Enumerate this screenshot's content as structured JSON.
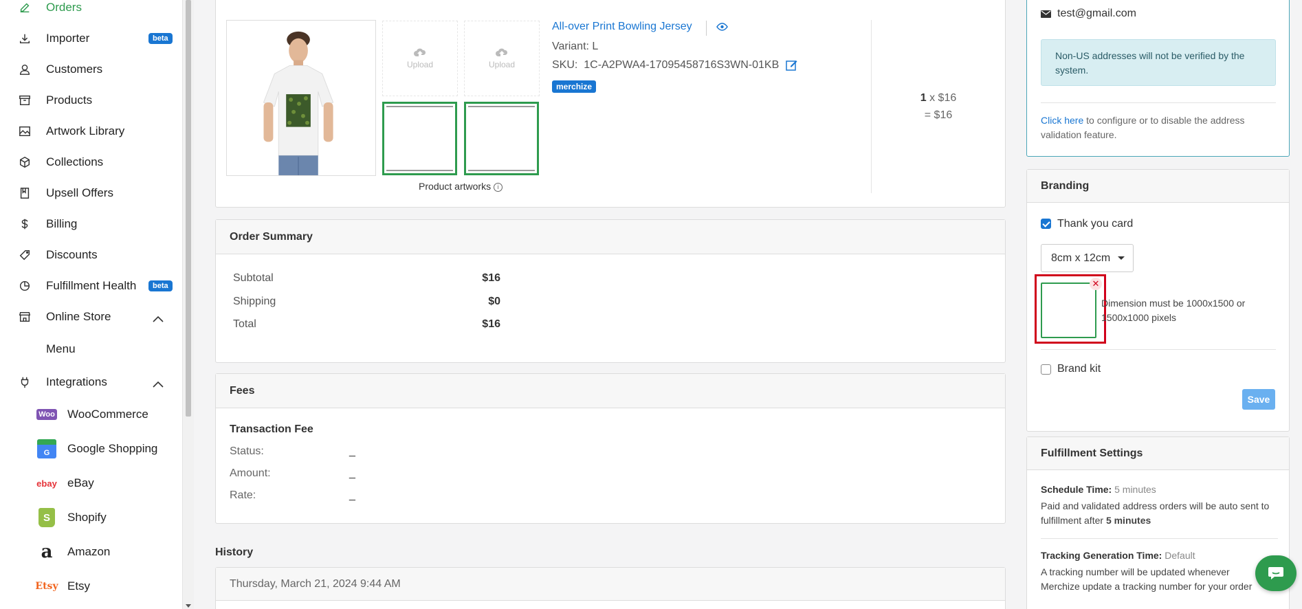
{
  "sidebar": {
    "items": [
      {
        "label": "Orders",
        "icon": "edit-icon"
      },
      {
        "label": "Importer",
        "icon": "download-icon",
        "badge": "beta"
      },
      {
        "label": "Customers",
        "icon": "user-icon"
      },
      {
        "label": "Products",
        "icon": "archive-icon"
      },
      {
        "label": "Artwork Library",
        "icon": "image-icon"
      },
      {
        "label": "Collections",
        "icon": "box-icon"
      },
      {
        "label": "Upsell Offers",
        "icon": "bookmark-icon"
      },
      {
        "label": "Billing",
        "icon": "dollar-icon"
      },
      {
        "label": "Discounts",
        "icon": "tag-icon"
      },
      {
        "label": "Fulfillment Health",
        "icon": "pie-chart-icon",
        "badge": "beta"
      },
      {
        "label": "Online Store",
        "icon": "store-icon"
      },
      {
        "label": "Integrations",
        "icon": "plug-icon"
      }
    ],
    "online_store_sub": [
      "Menu"
    ],
    "integrations_sub": [
      {
        "label": "WooCommerce",
        "logo_text": "Woo"
      },
      {
        "label": "Google Shopping",
        "logo_text": "G"
      },
      {
        "label": "eBay",
        "logo_text": "ebay"
      },
      {
        "label": "Shopify",
        "logo_text": "S"
      },
      {
        "label": "Amazon",
        "logo_text": "a"
      },
      {
        "label": "Etsy",
        "logo_text": "Etsy"
      }
    ]
  },
  "product": {
    "title": "All-over Print Bowling Jersey",
    "variant": "Variant: L",
    "sku_label": "SKU:",
    "sku": "1C-A2PWA4-17095458716S3WN-01KB",
    "tag": "merchize",
    "upload_label": "Upload",
    "artworks_caption": "Product artworks",
    "qty": "1",
    "unit_price": "x $16",
    "line_total": "= $16"
  },
  "order_summary": {
    "title": "Order Summary",
    "rows": [
      {
        "label": "Subtotal",
        "value": "$16"
      },
      {
        "label": "Shipping",
        "value": "$0"
      },
      {
        "label": "Total",
        "value": "$16"
      }
    ]
  },
  "fees": {
    "title": "Fees",
    "subtitle": "Transaction Fee",
    "rows": [
      {
        "label": "Status:",
        "value": "_"
      },
      {
        "label": "Amount:",
        "value": "_"
      },
      {
        "label": "Rate:",
        "value": "_"
      }
    ]
  },
  "history": {
    "title": "History",
    "entry_date": "Thursday, March 21, 2024 9:44 AM"
  },
  "address": {
    "email": "test@gmail.com",
    "notice": "Non-US addresses will not be verified by the system.",
    "click_here": "Click here",
    "config_text": "to configure or to disable the address validation feature."
  },
  "branding": {
    "title": "Branding",
    "thank_you_label": "Thank you card",
    "thank_you_checked": true,
    "size_value": "8cm x 12cm",
    "dimension_note": "Dimension must be 1000x1500 or 1500x1000 pixels",
    "brand_kit_label": "Brand kit",
    "brand_kit_checked": false,
    "save_label": "Save"
  },
  "fulfillment": {
    "title": "Fulfillment Settings",
    "schedule_label": "Schedule Time:",
    "schedule_value": "5 minutes",
    "schedule_desc": "Paid and validated address orders will be auto sent to fulfillment after",
    "schedule_desc_bold": "5 minutes",
    "tracking_label": "Tracking Generation Time:",
    "tracking_value": "Default",
    "tracking_desc": "A tracking number will be updated whenever Merchize update a tracking number for your order"
  },
  "colors": {
    "accent": "#2e9b4e",
    "link": "#1976d2",
    "highlight": "#d0021b",
    "notice_bg": "#d8eef2"
  }
}
